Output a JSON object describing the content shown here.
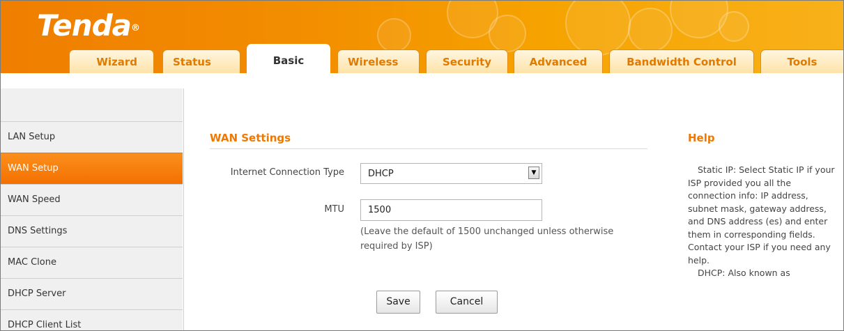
{
  "brand": {
    "logo": "Tenda",
    "mark": "®"
  },
  "nav": {
    "tabs": [
      {
        "label": "Wizard"
      },
      {
        "label": "Status"
      },
      {
        "label": "Basic",
        "active": true
      },
      {
        "label": "Wireless"
      },
      {
        "label": "Security"
      },
      {
        "label": "Advanced"
      },
      {
        "label": "Bandwidth Control"
      },
      {
        "label": "Tools"
      }
    ]
  },
  "sidebar": {
    "items": [
      {
        "label": "LAN Setup"
      },
      {
        "label": "WAN Setup",
        "active": true
      },
      {
        "label": "WAN Speed"
      },
      {
        "label": "DNS Settings"
      },
      {
        "label": "MAC Clone"
      },
      {
        "label": "DHCP Server"
      },
      {
        "label": "DHCP Client List"
      }
    ]
  },
  "main": {
    "section_title": "WAN Settings",
    "connection_type": {
      "label": "Internet Connection Type",
      "value": "DHCP"
    },
    "mtu": {
      "label": "MTU",
      "value": "1500",
      "hint_line1": "(Leave the default of 1500 unchanged unless otherwise",
      "hint_line2": "required by ISP)"
    },
    "buttons": {
      "save": "Save",
      "cancel": "Cancel"
    }
  },
  "help": {
    "title": "Help",
    "paragraph1": "Static IP: Select Static IP if your ISP provided you all the connection info: IP address, subnet mask, gateway address, and DNS address (es) and enter them in corresponding fields. Contact your ISP if you need any help.",
    "paragraph2": "DHCP: Also known as"
  },
  "colors": {
    "header_orange": "#f28d00",
    "accent_orange": "#f07800",
    "active_sidebar": "#f37000",
    "tab_text": "#e07a00"
  }
}
